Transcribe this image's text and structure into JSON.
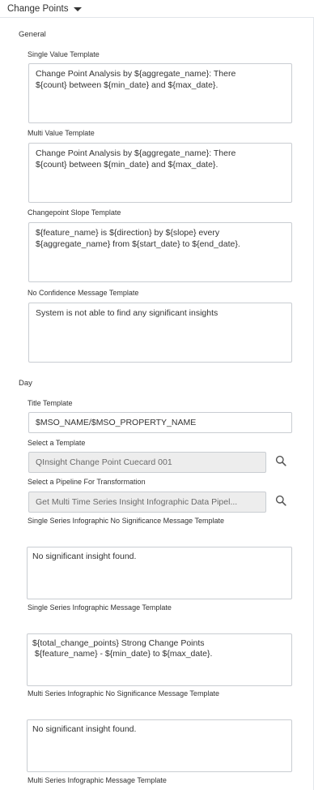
{
  "header": {
    "title": "Change Points"
  },
  "general": {
    "title": "General",
    "single_value": {
      "label": "Single Value Template",
      "value": "Change Point Analysis by ${aggregate_name}: There\n${count} between ${min_date} and ${max_date}."
    },
    "multi_value": {
      "label": "Multi Value Template",
      "value": "Change Point Analysis by ${aggregate_name}: There\n${count} between ${min_date} and ${max_date}."
    },
    "slope": {
      "label": "Changepoint Slope Template",
      "value": "${feature_name} is ${direction} by ${slope} every\n${aggregate_name} from ${start_date} to ${end_date}."
    },
    "no_confidence": {
      "label": "No Confidence Message Template",
      "value": "System is not able to find any significant insights"
    }
  },
  "day": {
    "title": "Day",
    "title_template": {
      "label": "Title Template",
      "value": "$MSO_NAME/$MSO_PROPERTY_NAME"
    },
    "template_select": {
      "label": "Select a Template",
      "value": "QInsight Change Point Cuecard 001"
    },
    "pipeline_select": {
      "label": "Select a Pipeline For Transformation",
      "value": "Get Multi Time Series Insight Infographic Data Pipel..."
    },
    "single_no_sig": {
      "label": "Single Series Infographic No Significance Message Template",
      "value": "No significant insight found."
    },
    "single_msg": {
      "label": "Single Series Infographic Message Template",
      "value": "${total_change_points} Strong Change Points\n ${feature_name} - ${min_date} to ${max_date}."
    },
    "multi_no_sig": {
      "label": "Multi Series Infographic No Significance Message Template",
      "value": "No significant insight found."
    },
    "multi_msg": {
      "label": "Multi Series Infographic Message Template"
    }
  },
  "icons": {
    "caret": "caret-down-icon",
    "search": "search-icon"
  }
}
